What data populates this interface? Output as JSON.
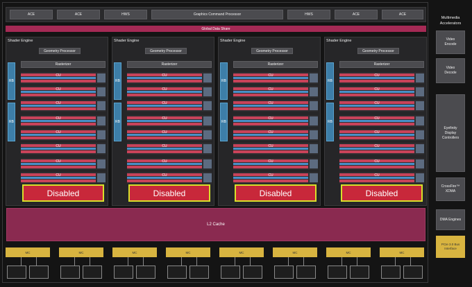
{
  "top_bar": {
    "blocks": [
      "ACE",
      "ACE",
      "HWS",
      "Graphics Command Processor",
      "HWS",
      "ACE",
      "ACE"
    ]
  },
  "gds": "Global Data Share",
  "shader_engines": [
    {
      "title": "Shader Engine",
      "geometry": "Geometry Processor",
      "rasterizer": "Rasterizer",
      "rb": [
        "RB",
        "RB"
      ],
      "cu": "CU",
      "disabled": "Disabled"
    },
    {
      "title": "Shader Engine",
      "geometry": "Geometry Processor",
      "rasterizer": "Rasterizer",
      "rb": [
        "RB",
        "RB"
      ],
      "cu": "CU",
      "disabled": "Disabled"
    },
    {
      "title": "Shader Engine",
      "geometry": "Geometry Processor",
      "rasterizer": "Rasterizer",
      "rb": [
        "RB",
        "RB"
      ],
      "cu": "CU",
      "disabled": "Disabled"
    },
    {
      "title": "Shader Engine",
      "geometry": "Geometry Processor",
      "rasterizer": "Rasterizer",
      "rb": [
        "RB",
        "RB"
      ],
      "cu": "CU",
      "disabled": "Disabled"
    }
  ],
  "l2": "L2 Cache",
  "mc_label": "MC",
  "right_column": {
    "title": "Multimedia Accelerators",
    "video_encode": "Video Encode",
    "video_decode": "Video Decode",
    "eyefinity": "Eyefinity Display Controllers",
    "crossfire": "CrossFire™ XDMA",
    "dma": "DMA Engines",
    "pcie": "PCIe 3.0 Bus Interface"
  },
  "colors": {
    "cu_red": "#c8435a",
    "cu_blue": "#4a90c8",
    "disabled_red": "#c8283a",
    "disabled_border": "#d8e02a",
    "mc_gold": "#d8b440",
    "l2": "#8a2a50",
    "gds": "#a52a55"
  }
}
